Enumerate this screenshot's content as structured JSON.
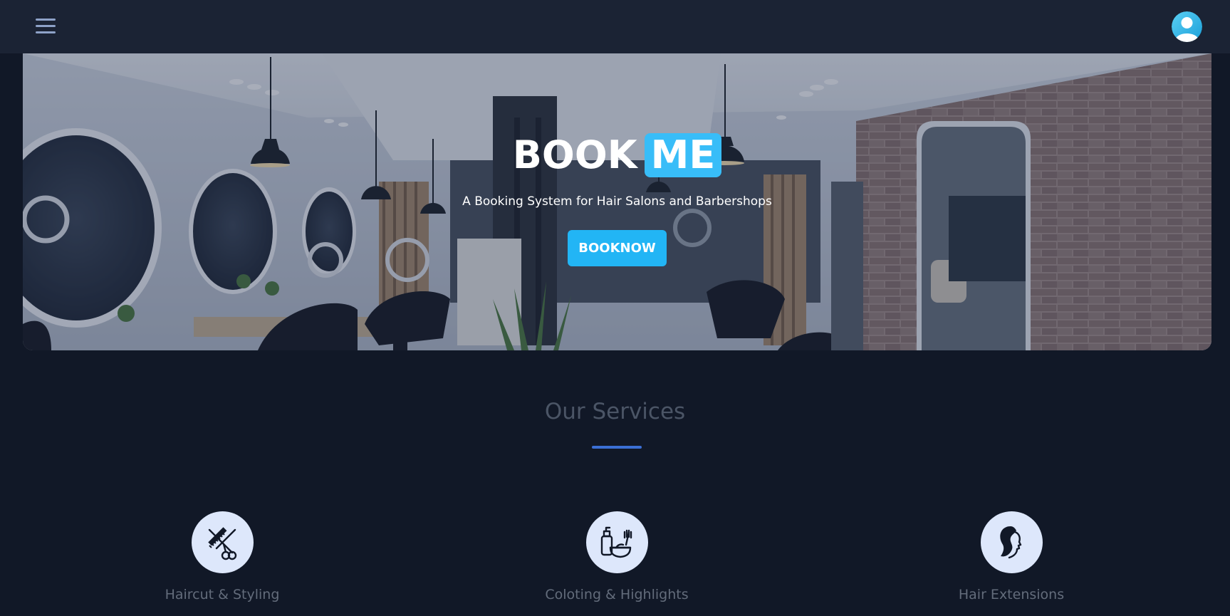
{
  "header": {
    "menu_icon": "hamburger-menu-icon",
    "avatar_icon": "user-avatar-icon"
  },
  "hero": {
    "title_main": "BOOK",
    "title_highlight": "ME",
    "subtitle": "A Booking System for Hair Salons and Barbershops",
    "cta_label": "BOOKNOW"
  },
  "services": {
    "title": "Our Services",
    "items": [
      {
        "label": "Haircut & Styling",
        "icon": "scissors-comb-icon"
      },
      {
        "label": "Coloting & Highlights",
        "icon": "hair-dye-icon"
      },
      {
        "label": "Hair Extensions",
        "icon": "woman-hair-icon"
      }
    ]
  },
  "colors": {
    "page_background": "#111827",
    "header_background": "#1b2334",
    "accent": "#38bdf8",
    "button": "#22b5f5",
    "underline": "#3b6fd4",
    "service_circle": "#dde7fb"
  }
}
